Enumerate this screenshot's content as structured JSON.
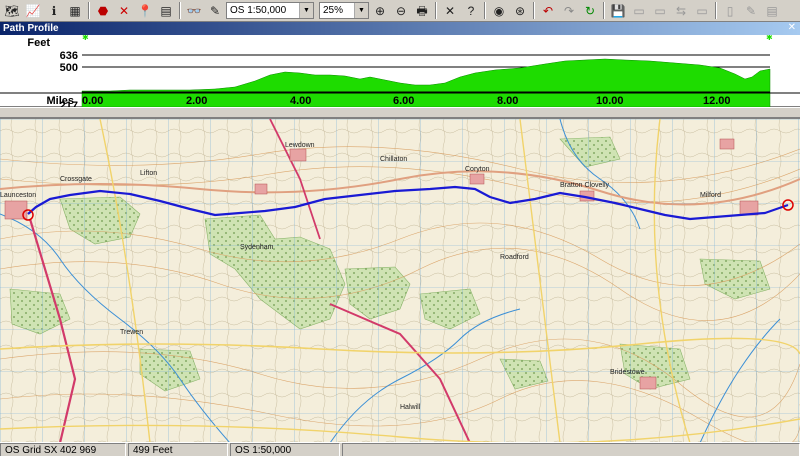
{
  "toolbar": {
    "scale_value": "OS 1:50,000",
    "zoom_value": "25%"
  },
  "profile": {
    "title": "Path Profile",
    "y_unit": "Feet",
    "x_unit": "Miles",
    "y_ticks": [
      "636",
      "500",
      "217"
    ],
    "x_ticks": [
      "0.00",
      "2.00",
      "4.00",
      "6.00",
      "8.00",
      "10.00",
      "12.00"
    ],
    "fill_color": "#1edc00"
  },
  "map": {
    "route_color": "#1a1ad4",
    "places": [
      "Launceston",
      "Crossgate",
      "Lifton",
      "Lewdown",
      "Chillaton",
      "Coryton",
      "Bratton Clovelly",
      "Milford",
      "Sydenham",
      "Roadford",
      "Trewen",
      "Bridestowe",
      "Halwill"
    ]
  },
  "statusbar": {
    "grid_ref": "OS Grid SX 402 969",
    "elevation": "499 Feet",
    "scale": "OS 1:50,000"
  }
}
